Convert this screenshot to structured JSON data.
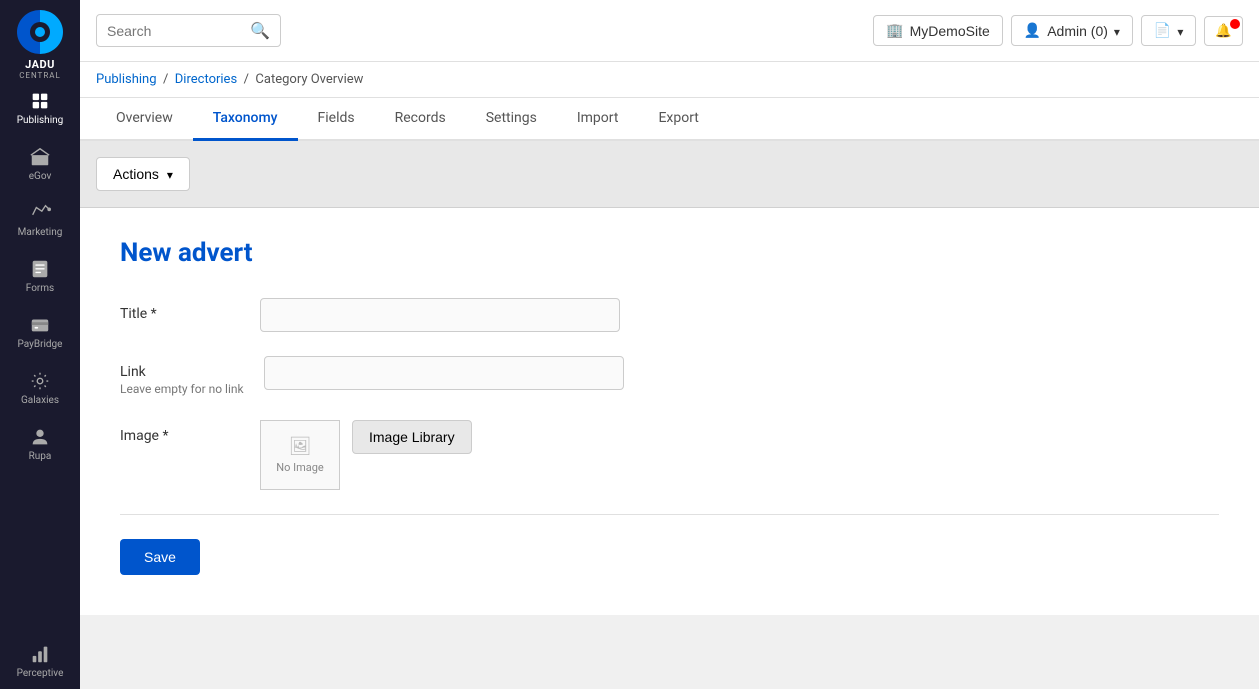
{
  "sidebar": {
    "logo_text": "JADU",
    "logo_sub": "CENTRAL",
    "items": [
      {
        "id": "publishing",
        "label": "Publishing",
        "icon": "publishing-icon",
        "active": true
      },
      {
        "id": "egov",
        "label": "eGov",
        "icon": "egov-icon"
      },
      {
        "id": "marketing",
        "label": "Marketing",
        "icon": "marketing-icon"
      },
      {
        "id": "forms",
        "label": "Forms",
        "icon": "forms-icon"
      },
      {
        "id": "paybridge",
        "label": "PayBridge",
        "icon": "paybridge-icon"
      },
      {
        "id": "galaxies",
        "label": "Galaxies",
        "icon": "galaxies-icon"
      },
      {
        "id": "rupa",
        "label": "Rupa",
        "icon": "rupa-icon"
      },
      {
        "id": "perceptive",
        "label": "Perceptive",
        "icon": "perceptive-icon"
      }
    ]
  },
  "topbar": {
    "search_placeholder": "Search",
    "site_name": "MyDemoSite",
    "admin_label": "Admin (0)",
    "search_icon": "search-icon",
    "site_icon": "site-icon",
    "admin_icon": "admin-icon",
    "docs_icon": "docs-icon",
    "notif_icon": "notification-icon"
  },
  "breadcrumb": {
    "parts": [
      {
        "label": "Publishing",
        "href": "#"
      },
      {
        "label": "Directories",
        "href": "#"
      },
      {
        "label": "Category Overview",
        "href": null
      }
    ]
  },
  "tabs": [
    {
      "id": "overview",
      "label": "Overview",
      "active": false
    },
    {
      "id": "taxonomy",
      "label": "Taxonomy",
      "active": true
    },
    {
      "id": "fields",
      "label": "Fields",
      "active": false
    },
    {
      "id": "records",
      "label": "Records",
      "active": false
    },
    {
      "id": "settings",
      "label": "Settings",
      "active": false
    },
    {
      "id": "import",
      "label": "Import",
      "active": false
    },
    {
      "id": "export",
      "label": "Export",
      "active": false
    }
  ],
  "actions": {
    "button_label": "Actions"
  },
  "form": {
    "title": "New advert",
    "title_label": "Title",
    "title_required": true,
    "title_value": "",
    "link_label": "Link",
    "link_hint": "Leave empty for no link",
    "link_value": "",
    "image_label": "Image",
    "image_required": true,
    "no_image_text": "No Image",
    "image_library_btn": "Image Library",
    "save_btn": "Save"
  }
}
